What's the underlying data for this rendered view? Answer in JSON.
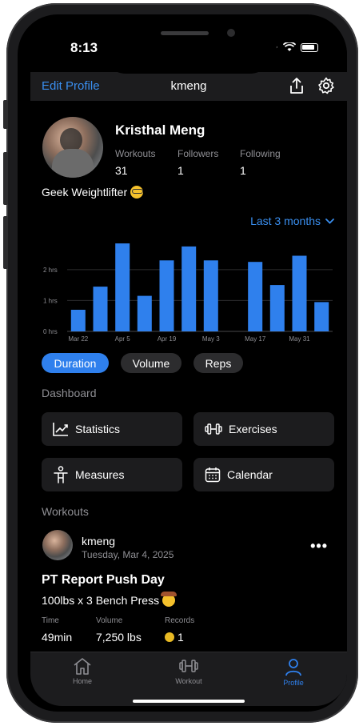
{
  "status_bar": {
    "time": "8:13"
  },
  "nav": {
    "edit_label": "Edit Profile",
    "title": "kmeng"
  },
  "profile": {
    "name": "Kristhal Meng",
    "stats": [
      {
        "label": "Workouts",
        "value": "31"
      },
      {
        "label": "Followers",
        "value": "1"
      },
      {
        "label": "Following",
        "value": "1"
      }
    ],
    "bio": "Geek Weightlifter"
  },
  "range": {
    "label": "Last 3 months"
  },
  "chart_data": {
    "type": "bar",
    "ylabel_ticks": [
      "0 hrs",
      "1 hrs",
      "2 hrs"
    ],
    "xticks": [
      "Mar 22",
      "Apr 5",
      "Apr 19",
      "May 3",
      "May 17",
      "May 31"
    ],
    "ylim": [
      0,
      2.8
    ],
    "values": [
      0.7,
      1.45,
      2.85,
      1.15,
      2.3,
      2.75,
      2.3,
      0,
      2.25,
      1.5,
      2.45,
      0.95
    ],
    "color": "#2f80ed",
    "grid": true
  },
  "metric_tabs": [
    {
      "label": "Duration",
      "active": true
    },
    {
      "label": "Volume",
      "active": false
    },
    {
      "label": "Reps",
      "active": false
    }
  ],
  "dashboard": {
    "title": "Dashboard",
    "items": [
      {
        "label": "Statistics",
        "icon": "chart-icon"
      },
      {
        "label": "Exercises",
        "icon": "dumbbell-icon"
      },
      {
        "label": "Measures",
        "icon": "person-icon"
      },
      {
        "label": "Calendar",
        "icon": "calendar-icon"
      }
    ]
  },
  "workouts": {
    "title": "Workouts",
    "post": {
      "user": "kmeng",
      "date": "Tuesday, Mar 4, 2025",
      "title": "PT Report Push Day",
      "description": "100lbs x 3 Bench Press",
      "stats": [
        {
          "label": "Time",
          "value": "49min"
        },
        {
          "label": "Volume",
          "value": "7,250 lbs"
        },
        {
          "label": "Records",
          "value": "1"
        }
      ]
    }
  },
  "tab_bar": {
    "items": [
      {
        "label": "Home",
        "active": false
      },
      {
        "label": "Workout",
        "active": false
      },
      {
        "label": "Profile",
        "active": true
      }
    ]
  }
}
